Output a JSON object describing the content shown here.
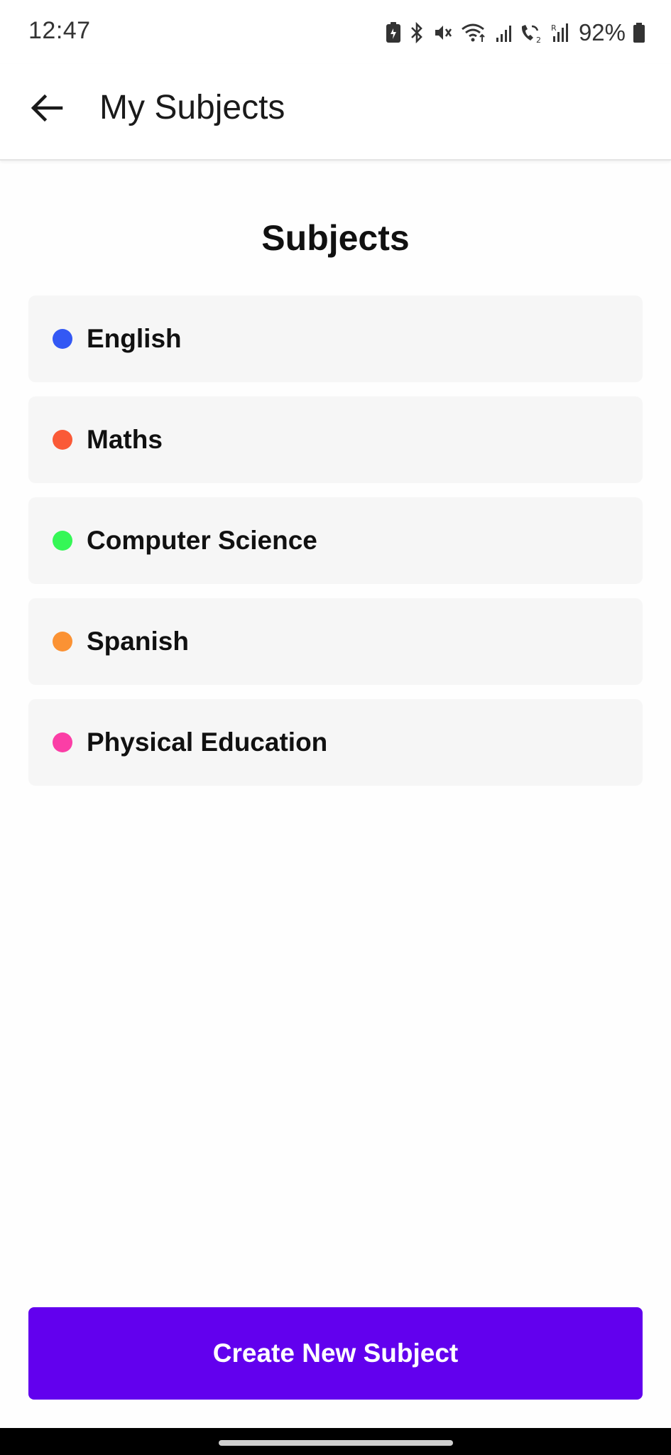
{
  "status_bar": {
    "time": "12:47",
    "battery_percent": "92%",
    "icons": [
      "battery-saver-icon",
      "bluetooth-icon",
      "vibrate-mute-icon",
      "wifi-icon",
      "signal-icon",
      "wifi-calling-icon",
      "roaming-signal-icon",
      "battery-icon"
    ]
  },
  "app_bar": {
    "back_icon": "arrow-left-icon",
    "title": "My Subjects"
  },
  "main": {
    "section_title": "Subjects",
    "subjects": [
      {
        "name": "English",
        "color": "#3358f4"
      },
      {
        "name": "Maths",
        "color": "#fa5a37"
      },
      {
        "name": "Computer Science",
        "color": "#35f756"
      },
      {
        "name": "Spanish",
        "color": "#fb9234"
      },
      {
        "name": "Physical Education",
        "color": "#fb3ea6"
      }
    ]
  },
  "actions": {
    "create_label": "Create New Subject",
    "create_color": "#6200ee"
  }
}
